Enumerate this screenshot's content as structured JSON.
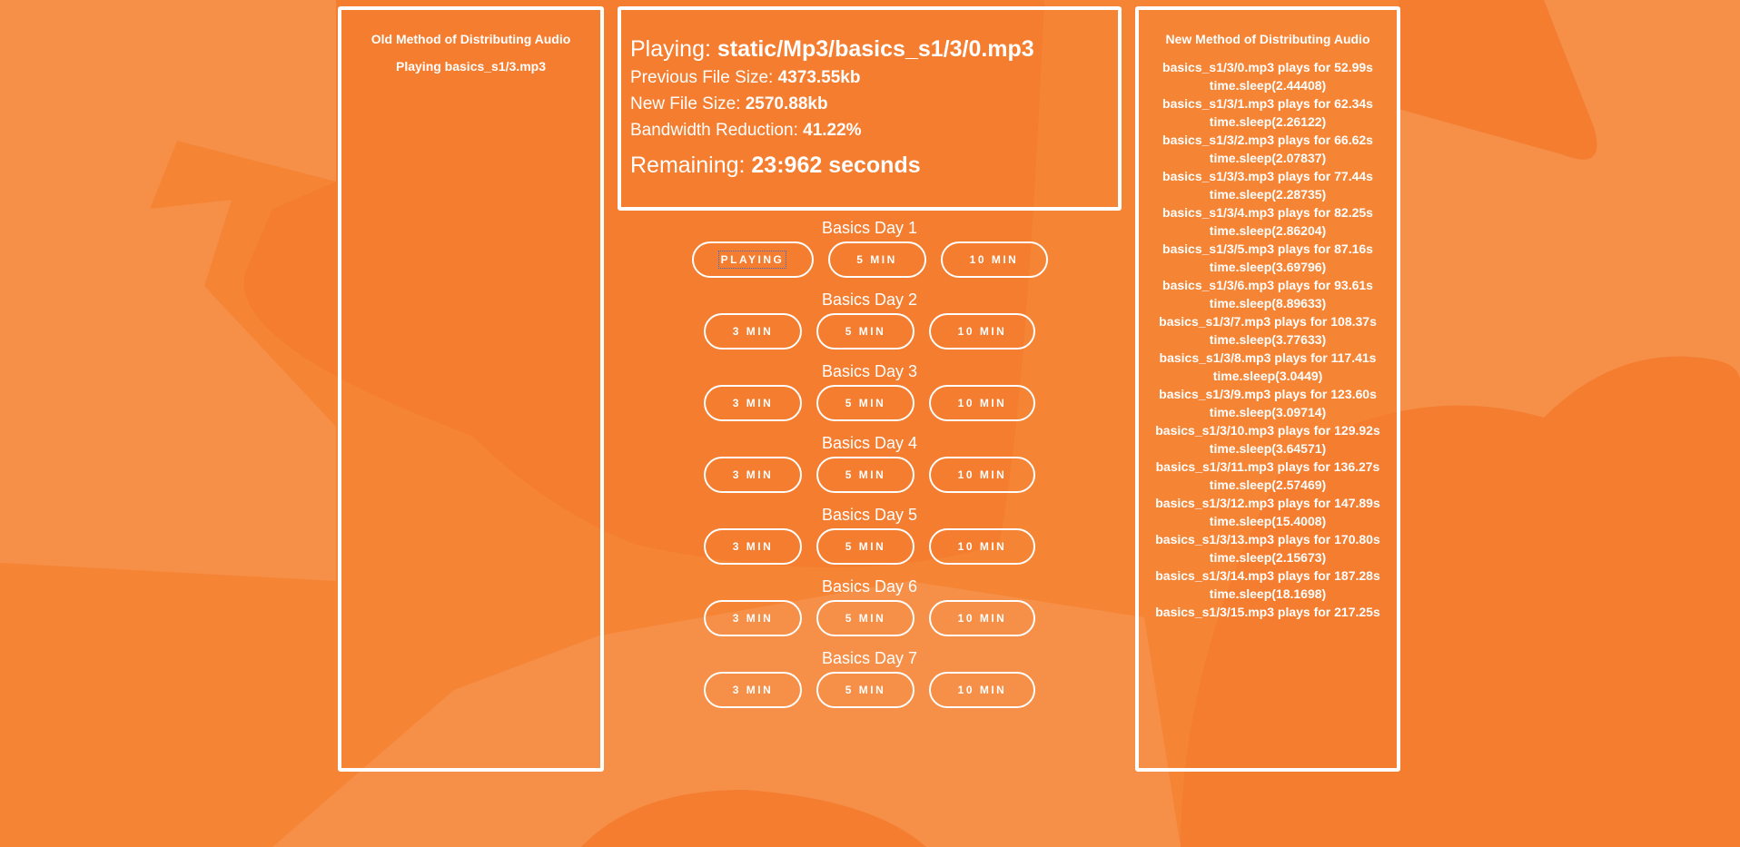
{
  "left": {
    "title": "Old Method of Distributing Audio",
    "playing": "Playing basics_s1/3.mp3"
  },
  "status": {
    "playing_label": "Playing:",
    "playing_value": "static/Mp3/basics_s1/3/0.mp3",
    "prev_label": "Previous File Size:",
    "prev_value": "4373.55kb",
    "new_label": "New File Size:",
    "new_value": "2570.88kb",
    "reduction_label": "Bandwidth Reduction:",
    "reduction_value": "41.22%",
    "remaining_label": "Remaining:",
    "remaining_value": "23:962 seconds"
  },
  "days": [
    {
      "title": "Basics Day 1",
      "buttons": [
        "PLAYING",
        "5 MIN",
        "10 MIN"
      ]
    },
    {
      "title": "Basics Day 2",
      "buttons": [
        "3 MIN",
        "5 MIN",
        "10 MIN"
      ]
    },
    {
      "title": "Basics Day 3",
      "buttons": [
        "3 MIN",
        "5 MIN",
        "10 MIN"
      ]
    },
    {
      "title": "Basics Day 4",
      "buttons": [
        "3 MIN",
        "5 MIN",
        "10 MIN"
      ]
    },
    {
      "title": "Basics Day 5",
      "buttons": [
        "3 MIN",
        "5 MIN",
        "10 MIN"
      ]
    },
    {
      "title": "Basics Day 6",
      "buttons": [
        "3 MIN",
        "5 MIN",
        "10 MIN"
      ]
    },
    {
      "title": "Basics Day 7",
      "buttons": [
        "3 MIN",
        "5 MIN",
        "10 MIN"
      ]
    }
  ],
  "right": {
    "title": "New Method of Distributing Audio",
    "rows": [
      "basics_s1/3/0.mp3 plays for 52.99s",
      "time.sleep(2.44408)",
      "basics_s1/3/1.mp3 plays for 62.34s",
      "time.sleep(2.26122)",
      "basics_s1/3/2.mp3 plays for 66.62s",
      "time.sleep(2.07837)",
      "basics_s1/3/3.mp3 plays for 77.44s",
      "time.sleep(2.28735)",
      "basics_s1/3/4.mp3 plays for 82.25s",
      "time.sleep(2.86204)",
      "basics_s1/3/5.mp3 plays for 87.16s",
      "time.sleep(3.69796)",
      "basics_s1/3/6.mp3 plays for 93.61s",
      "time.sleep(8.89633)",
      "basics_s1/3/7.mp3 plays for 108.37s",
      "time.sleep(3.77633)",
      "basics_s1/3/8.mp3 plays for 117.41s",
      "time.sleep(3.0449)",
      "basics_s1/3/9.mp3 plays for 123.60s",
      "time.sleep(3.09714)",
      "basics_s1/3/10.mp3 plays for 129.92s",
      "time.sleep(3.64571)",
      "basics_s1/3/11.mp3 plays for 136.27s",
      "time.sleep(2.57469)",
      "basics_s1/3/12.mp3 plays for 147.89s",
      "time.sleep(15.4008)",
      "basics_s1/3/13.mp3 plays for 170.80s",
      "time.sleep(2.15673)",
      "basics_s1/3/14.mp3 plays for 187.28s",
      "time.sleep(18.1698)",
      "basics_s1/3/15.mp3 plays for 217.25s"
    ]
  },
  "colors": {
    "background": "#f58535",
    "shape_light": "#f68f48",
    "shape_dark": "#f47d2f",
    "text": "#ffffff"
  }
}
